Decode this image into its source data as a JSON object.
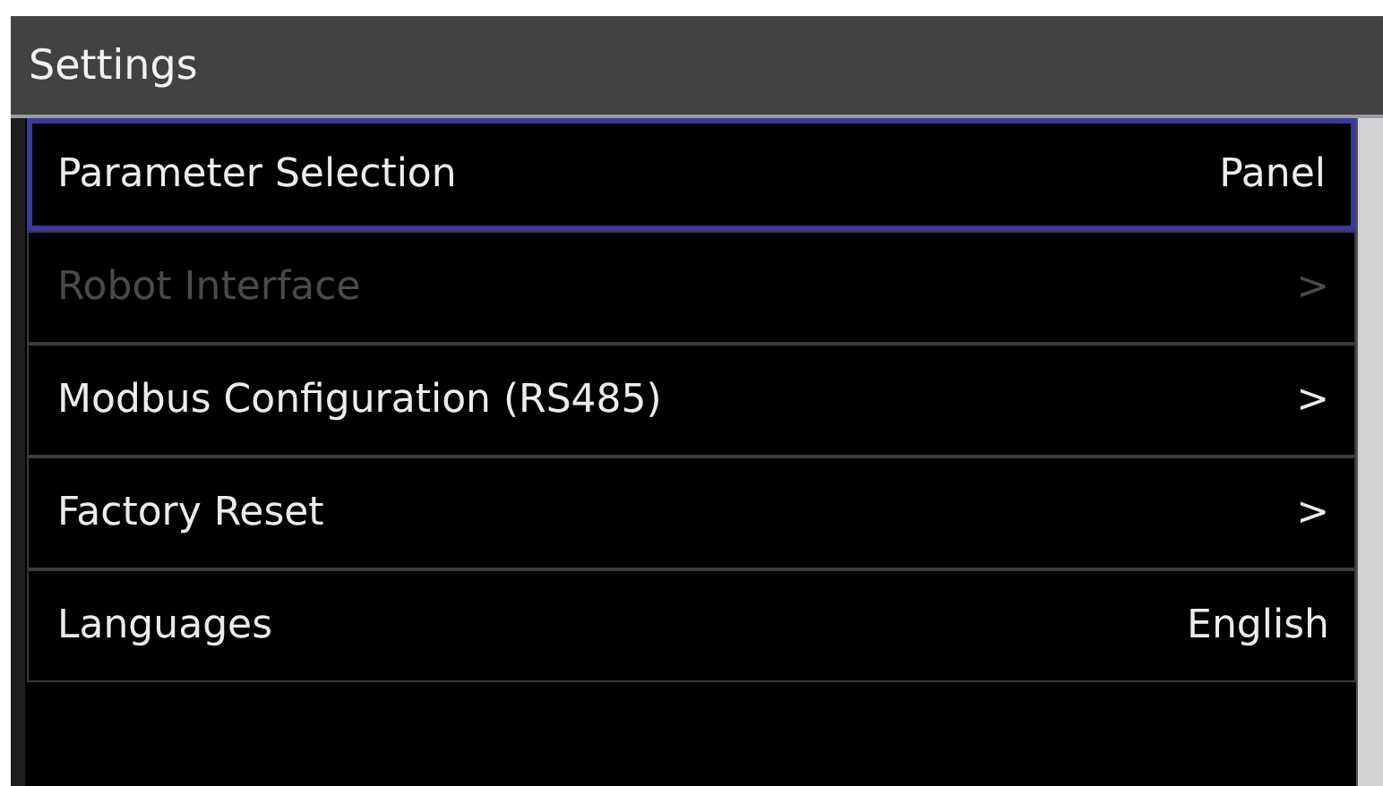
{
  "window": {
    "title": "Settings"
  },
  "items": [
    {
      "label": "Parameter Selection",
      "value": "Panel",
      "selected": true,
      "disabled": false
    },
    {
      "label": "Robot Interface",
      "value": ">",
      "selected": false,
      "disabled": true
    },
    {
      "label": "Modbus Configuration (RS485)",
      "value": ">",
      "selected": false,
      "disabled": false
    },
    {
      "label": "Factory Reset",
      "value": ">",
      "selected": false,
      "disabled": false
    },
    {
      "label": "Languages",
      "value": "English",
      "selected": false,
      "disabled": false
    }
  ]
}
